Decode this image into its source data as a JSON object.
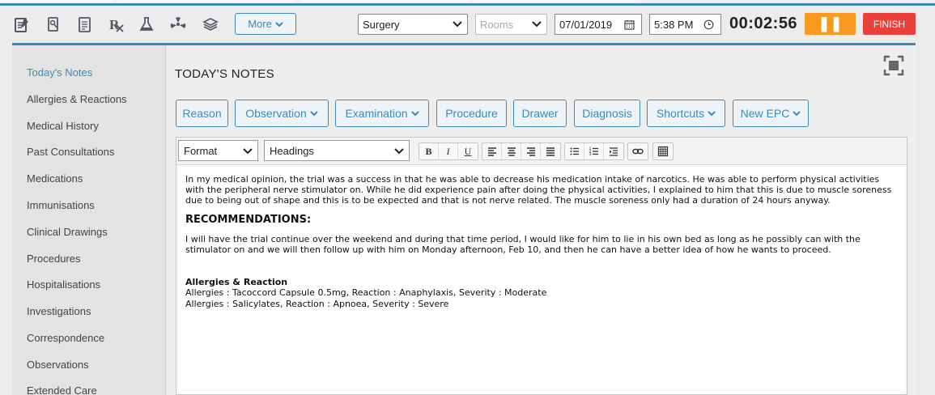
{
  "header": {
    "icons": [
      "notes-icon",
      "lab-request-icon",
      "document-icon",
      "prescription-icon",
      "lab-flask-icon",
      "radiation-icon",
      "layers-icon"
    ],
    "more_label": "More",
    "location_select": "Surgery",
    "rooms_placeholder": "Rooms",
    "date": "07/01/2019",
    "time": "5:38 PM",
    "timer": "00:02:56",
    "pause_label": "❚❚",
    "finish_label": "FINISH"
  },
  "sidebar": {
    "items": [
      {
        "label": "Today's Notes",
        "active": true
      },
      {
        "label": "Allergies & Reactions"
      },
      {
        "label": "Medical History"
      },
      {
        "label": "Past Consultations"
      },
      {
        "label": "Medications"
      },
      {
        "label": "Immunisations"
      },
      {
        "label": "Clinical Drawings"
      },
      {
        "label": "Procedures"
      },
      {
        "label": "Hospitalisations"
      },
      {
        "label": "Investigations"
      },
      {
        "label": "Correspondence"
      },
      {
        "label": "Observations"
      },
      {
        "label": "Extended Care"
      }
    ]
  },
  "main": {
    "title": "TODAY'S NOTES",
    "tabs": [
      {
        "label": "Reason",
        "dropdown": false
      },
      {
        "label": "Observation",
        "dropdown": true
      },
      {
        "label": "Examination",
        "dropdown": true
      },
      {
        "label": "Procedure",
        "dropdown": false
      },
      {
        "label": "Drawer",
        "dropdown": false
      },
      {
        "label": "Diagnosis",
        "dropdown": false
      },
      {
        "label": "Shortcuts",
        "dropdown": true
      },
      {
        "label": "New EPC",
        "dropdown": true
      }
    ]
  },
  "editor": {
    "format_select": "Format",
    "style_select": "Headings",
    "buttons": {
      "bold": "B",
      "italic": "I",
      "underline": "U"
    },
    "content": {
      "para1": "In my medical opinion, the trial was a success in that he was able to decrease his medication intake of narcotics.  He was able to perform physical activities with the peripheral nerve stimulator on.  While he did experience pain after doing the physical activities, I explained to him that this is due to muscle soreness due to being out of shape and this is to be expected and that is not nerve related.  The muscle soreness only had a duration of 24 hours anyway.",
      "heading": "RECOMMENDATIONS:",
      "para2": "I will have the trial continue over the weekend and during that time period, I would like for him to lie in his own bed as long as he possibly can with the stimulator on and we will then follow up with him on Monday afternoon, Feb 10, and then he can have a better idea of how he wants to proceed.",
      "allergy_heading": "Allergies & Reaction",
      "allergy1": "Allergies : Tacoccord Capsule 0.5mg, Reaction : Anaphylaxis, Severity : Moderate",
      "allergy2": "Allergies : Salicylates, Reaction : Apnoea, Severity : Severe"
    }
  },
  "colors": {
    "accent": "#3d8ab8",
    "pause": "#f79a1f",
    "finish": "#e9413a"
  }
}
